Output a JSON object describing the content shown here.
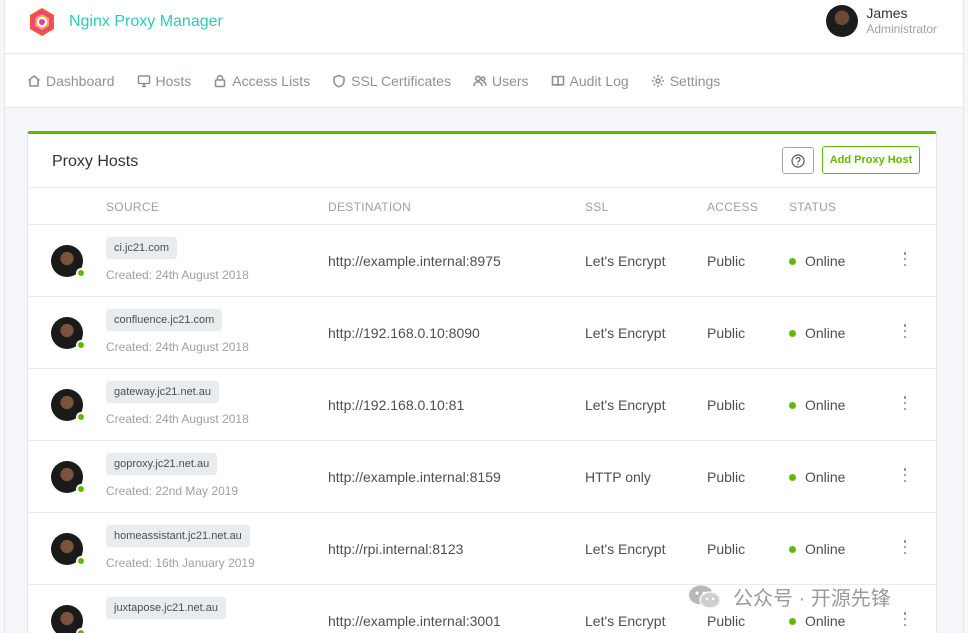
{
  "app": {
    "title": "Nginx Proxy Manager",
    "brand_color": "#2bcbba",
    "accent_color": "#5eba00"
  },
  "user": {
    "name": "James",
    "role": "Administrator"
  },
  "nav": [
    {
      "label": "Dashboard",
      "icon": "home-icon"
    },
    {
      "label": "Hosts",
      "icon": "monitor-icon"
    },
    {
      "label": "Access Lists",
      "icon": "lock-icon"
    },
    {
      "label": "SSL Certificates",
      "icon": "shield-icon"
    },
    {
      "label": "Users",
      "icon": "users-icon"
    },
    {
      "label": "Audit Log",
      "icon": "book-icon"
    },
    {
      "label": "Settings",
      "icon": "gear-icon"
    }
  ],
  "card": {
    "title": "Proxy Hosts",
    "add_label": "Add Proxy Host"
  },
  "table": {
    "columns": [
      "SOURCE",
      "DESTINATION",
      "SSL",
      "ACCESS",
      "STATUS"
    ],
    "rows": [
      {
        "domain": "ci.jc21.com",
        "created": "Created: 24th August 2018",
        "destination": "http://example.internal:8975",
        "ssl": "Let's Encrypt",
        "access": "Public",
        "status": "Online"
      },
      {
        "domain": "confluence.jc21.com",
        "created": "Created: 24th August 2018",
        "destination": "http://192.168.0.10:8090",
        "ssl": "Let's Encrypt",
        "access": "Public",
        "status": "Online"
      },
      {
        "domain": "gateway.jc21.net.au",
        "created": "Created: 24th August 2018",
        "destination": "http://192.168.0.10:81",
        "ssl": "Let's Encrypt",
        "access": "Public",
        "status": "Online"
      },
      {
        "domain": "goproxy.jc21.net.au",
        "created": "Created: 22nd May 2019",
        "destination": "http://example.internal:8159",
        "ssl": "HTTP only",
        "access": "Public",
        "status": "Online"
      },
      {
        "domain": "homeassistant.jc21.net.au",
        "created": "Created: 16th January 2019",
        "destination": "http://rpi.internal:8123",
        "ssl": "Let's Encrypt",
        "access": "Public",
        "status": "Online"
      },
      {
        "domain": "juxtapose.jc21.net.au",
        "created": "",
        "destination": "http://example.internal:3001",
        "ssl": "Let's Encrypt",
        "access": "Public",
        "status": "Online"
      }
    ]
  },
  "watermark": {
    "text": "公众号 · 开源先锋"
  }
}
